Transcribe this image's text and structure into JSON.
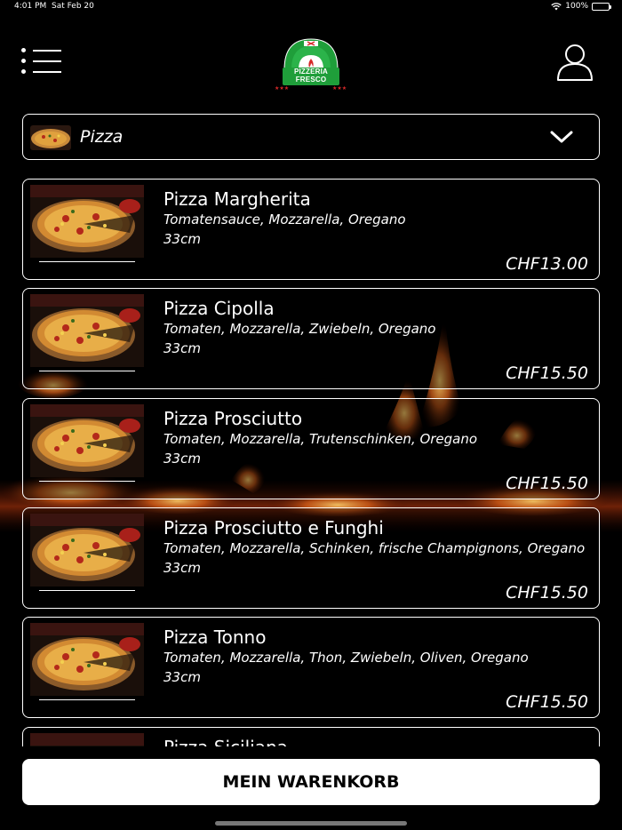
{
  "status": {
    "time": "4:01 PM",
    "date": "Sat Feb 20",
    "battery": "100%"
  },
  "header": {
    "logo_line1": "PIZZERIA",
    "logo_line2": "FRESCO",
    "logo_url": "www.fresco-pizza.ch"
  },
  "category": {
    "selected": "Pizza"
  },
  "products": [
    {
      "name": "Pizza Margherita",
      "description": "Tomatensauce, Mozzarella, Oregano",
      "size": "33cm",
      "price": "CHF13.00"
    },
    {
      "name": "Pizza Cipolla",
      "description": "Tomaten, Mozzarella, Zwiebeln, Oregano",
      "size": "33cm",
      "price": "CHF15.50"
    },
    {
      "name": "Pizza Prosciutto",
      "description": "Tomaten, Mozzarella, Trutenschinken, Oregano",
      "size": "33cm",
      "price": "CHF15.50"
    },
    {
      "name": "Pizza Prosciutto e Funghi",
      "description": "Tomaten, Mozzarella, Schinken, frische Champignons, Oregano",
      "size": "33cm",
      "price": "CHF15.50"
    },
    {
      "name": "Pizza Tonno",
      "description": "Tomaten, Mozzarella, Thon, Zwiebeln, Oliven, Oregano",
      "size": "33cm",
      "price": "CHF15.50"
    },
    {
      "name": "Pizza Siciliana",
      "description": "",
      "size": "",
      "price": ""
    }
  ],
  "cart": {
    "label": "MEIN WARENKORB"
  },
  "colors": {
    "background": "#000000",
    "accent_green": "#1f9e3a",
    "accent_red": "#d62828",
    "button_bg": "#ffffff"
  }
}
